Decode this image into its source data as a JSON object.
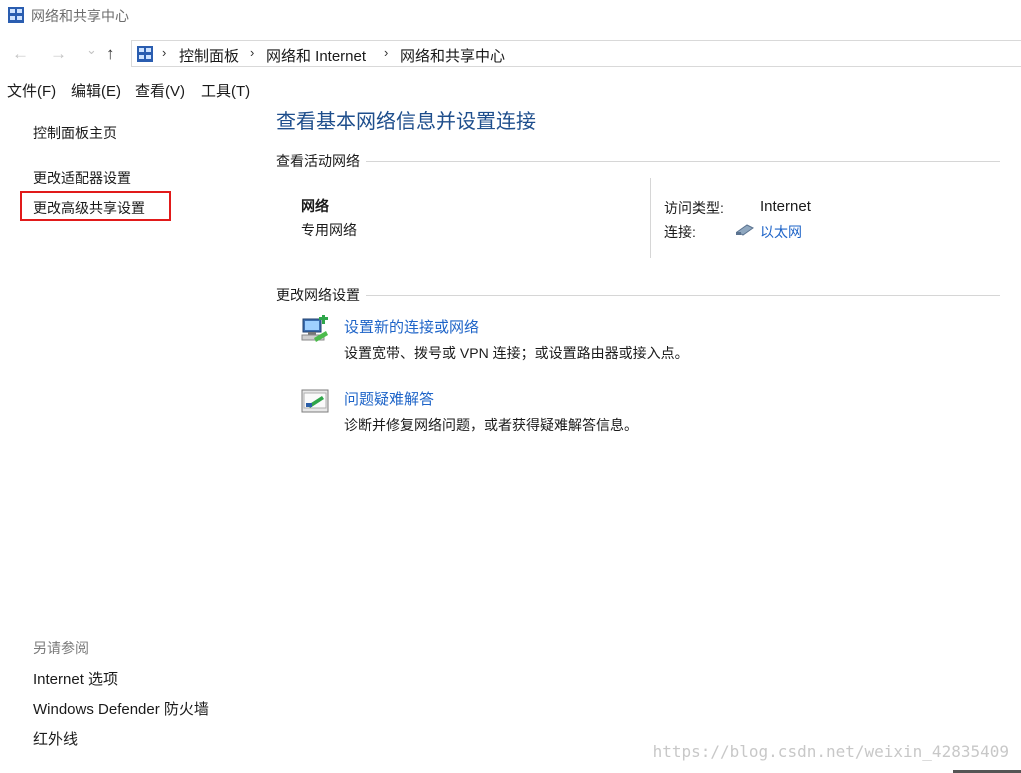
{
  "window": {
    "title": "网络和共享中心"
  },
  "nav": {
    "back_glyph": "←",
    "forward_glyph": "→",
    "recent_glyph": "⌄",
    "up_glyph": "↑",
    "breadcrumbs": [
      "控制面板",
      "网络和 Internet",
      "网络和共享中心"
    ],
    "separator": "›"
  },
  "menu": [
    "文件(F)",
    "编辑(E)",
    "查看(V)",
    "工具(T)"
  ],
  "sidebar": {
    "home": "控制面板主页",
    "adapter": "更改适配器设置",
    "advanced_sharing": "更改高级共享设置",
    "see_also_header": "另请参阅",
    "see_also": [
      "Internet 选项",
      "Windows Defender 防火墙",
      "红外线"
    ]
  },
  "main": {
    "title": "查看基本网络信息并设置连接",
    "active_networks": {
      "header": "查看活动网络",
      "name": "网络",
      "type": "专用网络",
      "access_label": "访问类型:",
      "access_value": "Internet",
      "connection_label": "连接:",
      "connection_value": "以太网"
    },
    "change_settings": {
      "header": "更改网络设置",
      "tasks": [
        {
          "title": "设置新的连接或网络",
          "desc": "设置宽带、拨号或 VPN 连接；或设置路由器或接入点。",
          "icon": "network-setup-icon"
        },
        {
          "title": "问题疑难解答",
          "desc": "诊断并修复网络问题，或者获得疑难解答信息。",
          "icon": "troubleshoot-icon"
        }
      ]
    }
  },
  "watermark": "https://blog.csdn.net/weixin_42835409",
  "colors": {
    "accent_link": "#1e64c8",
    "title_blue": "#1e4e8c",
    "highlight_red": "#e11a1a"
  }
}
